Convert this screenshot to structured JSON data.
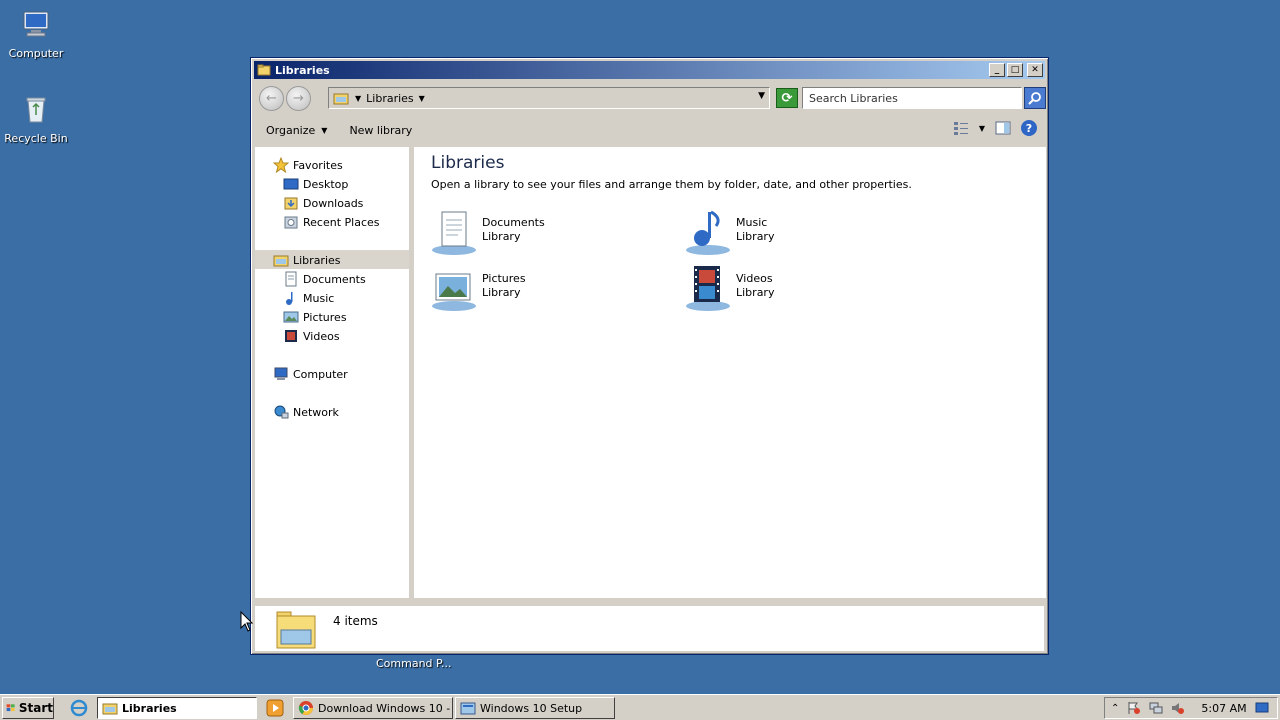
{
  "desktop": {
    "icons": [
      {
        "label": "Computer",
        "icon": "computer-icon"
      },
      {
        "label": "Recycle Bin",
        "icon": "recycle-bin-icon"
      }
    ],
    "background_color": "#3a6ea5",
    "cmd_label": "Command P..."
  },
  "window": {
    "title": "Libraries",
    "address": {
      "crumb": "Libraries"
    },
    "search": {
      "placeholder": "Search Libraries"
    },
    "toolbar": {
      "organize": "Organize",
      "new_library": "New library"
    },
    "nav": {
      "favorites": "Favorites",
      "desktop": "Desktop",
      "downloads": "Downloads",
      "recent_places": "Recent Places",
      "libraries": "Libraries",
      "documents": "Documents",
      "music": "Music",
      "pictures": "Pictures",
      "videos": "Videos",
      "computer": "Computer",
      "network": "Network"
    },
    "content": {
      "heading": "Libraries",
      "subtitle": "Open a library to see your files and arrange them by folder, date, and other properties.",
      "libraries": [
        {
          "name": "Documents",
          "type": "Library"
        },
        {
          "name": "Music",
          "type": "Library"
        },
        {
          "name": "Pictures",
          "type": "Library"
        },
        {
          "name": "Videos",
          "type": "Library"
        }
      ]
    },
    "status": {
      "count": "4 items"
    }
  },
  "taskbar": {
    "start": "Start",
    "tasks": [
      {
        "label": "Libraries",
        "active": true
      },
      {
        "label": "Download Windows 10 - ..."
      },
      {
        "label": "Windows 10 Setup"
      }
    ],
    "clock": "5:07 AM"
  }
}
